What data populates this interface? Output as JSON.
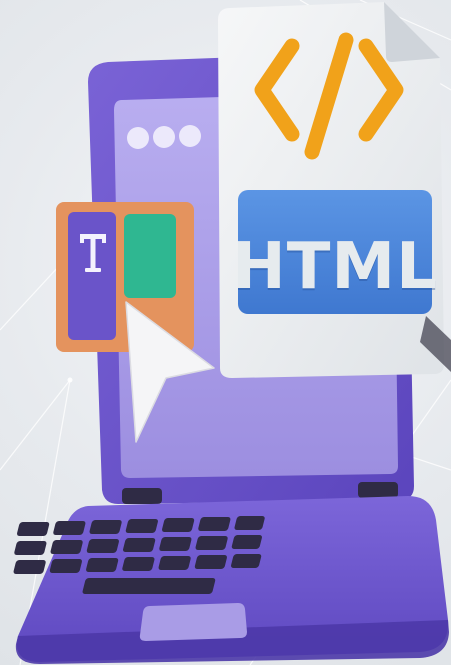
{
  "illustration": {
    "badge_text": "HTML",
    "icons": {
      "code_glyph": "code-brackets-icon",
      "text_tool": "text-tool-icon",
      "cursor": "cursor-arrow-icon",
      "window_dots": "window-dots-icon"
    },
    "colors": {
      "laptop_purple": "#6a54c9",
      "screen_lavender": "#a99ce6",
      "badge_blue": "#4a86dc",
      "code_orange": "#f1a21a",
      "panel_orange": "#e4935e",
      "swatch_green": "#2fb791",
      "keys_dark": "#2f2b45",
      "document_white": "#eef0f2"
    }
  }
}
